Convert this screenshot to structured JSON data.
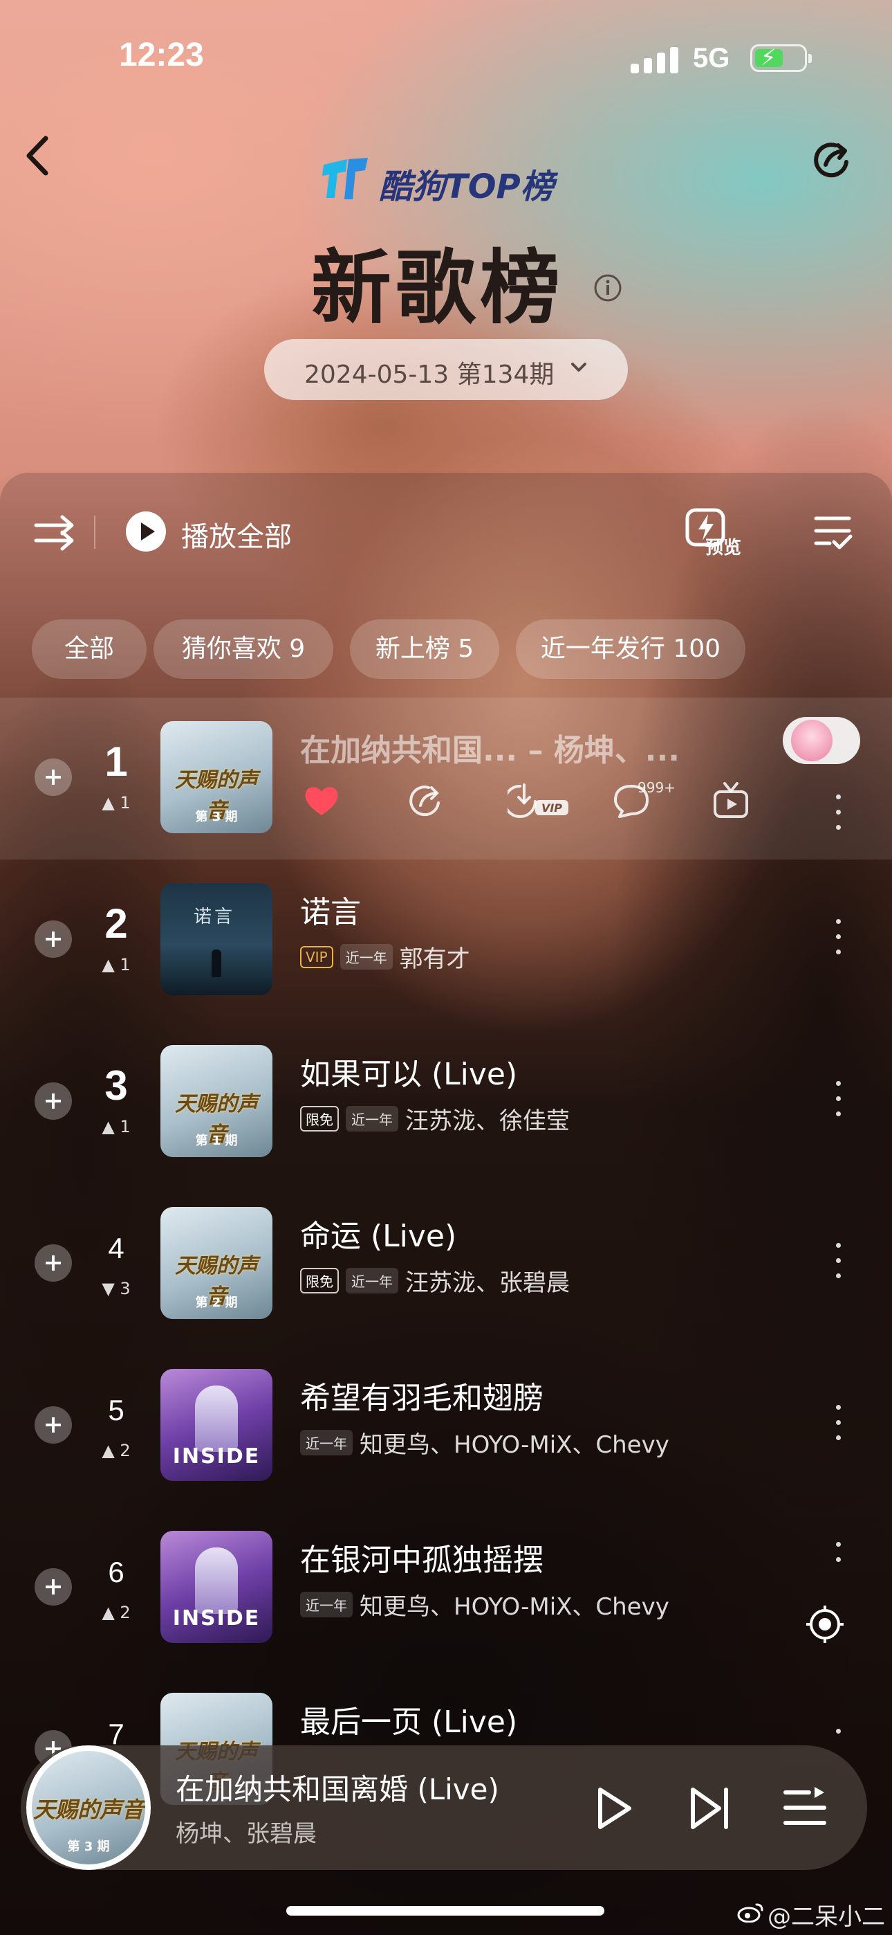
{
  "status": {
    "time": "12:23",
    "network": "5G",
    "battery_charging": true
  },
  "header": {
    "brand": "酷狗TOP榜",
    "title": "新歌榜",
    "period": "2024-05-13 第134期"
  },
  "toolbar": {
    "play_all": "播放全部",
    "preview": "预览"
  },
  "filters": [
    {
      "label": "全部"
    },
    {
      "label": "猜你喜欢 9"
    },
    {
      "label": "新上榜 5"
    },
    {
      "label": "近一年发行 100"
    }
  ],
  "songs": [
    {
      "rank": "1",
      "trend": "▲ 1",
      "title": "在加纳共和国... – 杨坤、...",
      "cover": "天赐的声音",
      "cover_ep": "第 3 期",
      "comment_count": "999+"
    },
    {
      "rank": "2",
      "trend": "▲ 1",
      "title": "诺言",
      "tags": [
        "VIP",
        "近一年"
      ],
      "artist": "郭有才",
      "cover": "诺言"
    },
    {
      "rank": "3",
      "trend": "▲ 1",
      "title": "如果可以 (Live)",
      "tags": [
        "限免",
        "近一年"
      ],
      "artist": "汪苏泷、徐佳莹",
      "cover": "天赐的声音",
      "cover_ep": "第 1 期"
    },
    {
      "rank": "4",
      "trend": "▼ 3",
      "title": "命运 (Live)",
      "tags": [
        "限免",
        "近一年"
      ],
      "artist": "汪苏泷、张碧晨",
      "cover": "天赐的声音",
      "cover_ep": "第 2 期"
    },
    {
      "rank": "5",
      "trend": "▲ 2",
      "title": "希望有羽毛和翅膀",
      "tags": [
        "近一年"
      ],
      "artist": "知更鸟、HOYO-MiX、Chevy",
      "cover": "INSIDE"
    },
    {
      "rank": "6",
      "trend": "▲ 2",
      "title": "在银河中孤独摇摆",
      "tags": [
        "近一年"
      ],
      "artist": "知更鸟、HOYO-MiX、Chevy",
      "cover": "INSIDE"
    },
    {
      "rank": "7",
      "trend": "",
      "title": "最后一页 (Live)",
      "cover": "天赐的声音"
    }
  ],
  "player": {
    "title": "在加纳共和国离婚 (Live)",
    "artist": "杨坤、张碧晨",
    "cover": "天赐的声音",
    "cover_ep": "第 3 期"
  },
  "watermark": "@二呆小二",
  "colors": {
    "accent_red": "#ff4d5e",
    "vip_gold": "#e7b34a",
    "brand_blue": "#27357a"
  }
}
